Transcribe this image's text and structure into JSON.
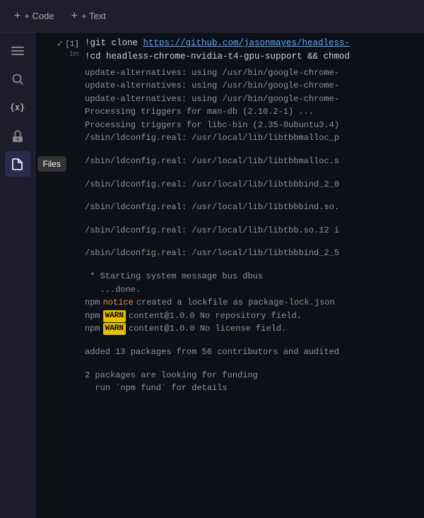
{
  "toolbar": {
    "code_btn": "+ Code",
    "text_btn": "+ Text"
  },
  "sidebar": {
    "icons": [
      {
        "name": "menu-icon",
        "symbol": "≡",
        "active": false
      },
      {
        "name": "search-icon",
        "symbol": "🔍",
        "active": false
      },
      {
        "name": "braces-icon",
        "symbol": "{x}",
        "active": false
      },
      {
        "name": "key-icon",
        "symbol": "🔑",
        "active": false
      },
      {
        "name": "files-icon",
        "symbol": "📄",
        "active": true,
        "tooltip": "Files"
      }
    ]
  },
  "cell": {
    "number": "[1]",
    "check": "✓",
    "time": "1m",
    "command1": "!git clone https://github.com/jasonmayes/headless-",
    "command2": "!cd headless-chrome-nvidia-t4-gpu-support && chmod",
    "output_lines": [
      "update-alternatives: using /usr/bin/google-chrome-",
      "update-alternatives: using /usr/bin/google-chrome-",
      "update-alternatives: using /usr/bin/google-chrome-",
      "Processing triggers for man-db (2.10.2-1) ...",
      "Processing triggers for libc-bin (2.35-0ubuntu3.4)",
      "/sbin/ldconfig.real: /usr/local/lib/libtbbmalloc_p"
    ],
    "blank1": "",
    "ldconfig_lines": [
      "/sbin/ldconfig.real: /usr/local/lib/libtbbmalloc.s",
      "",
      "/sbin/ldconfig.real: /usr/local/lib/libtbbbind_2_0",
      "",
      "/sbin/ldconfig.real: /usr/local/lib/libtbbbind.so.",
      "",
      "/sbin/ldconfig.real: /usr/local/lib/libtbb.so.12 i",
      "",
      "/sbin/ldconfig.real: /usr/local/lib/libtbbbind_2_5"
    ],
    "system_lines": [
      " * Starting system message bus dbus",
      "   ...done."
    ],
    "npm_lines": [
      {
        "prefix": "npm",
        "badge_type": "notice",
        "badge": "notice",
        "text": "created a lockfile as package-lock.json"
      },
      {
        "prefix": "npm",
        "badge_type": "warn",
        "badge": "WARN",
        "text": "content@1.0.0 No repository field."
      },
      {
        "prefix": "npm",
        "badge_type": "warn",
        "badge": "WARN",
        "text": "content@1.0.0 No license field."
      }
    ],
    "audit_line": "added 13 packages from 56 contributors and audited",
    "funding_lines": [
      "2 packages are looking for funding",
      "  run `npm fund` for details"
    ]
  }
}
